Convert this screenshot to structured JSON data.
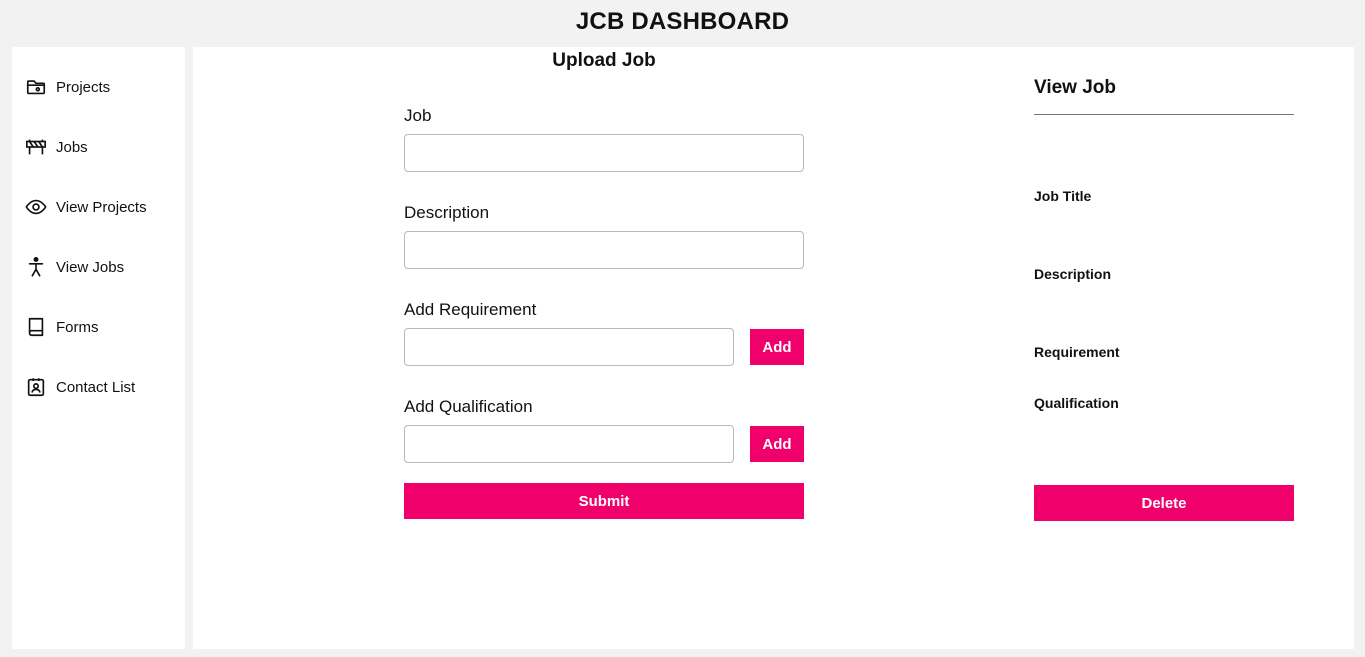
{
  "header": {
    "title": "JCB DASHBOARD"
  },
  "sidebar": {
    "items": [
      {
        "label": "Projects",
        "icon": "folder-icon"
      },
      {
        "label": "Jobs",
        "icon": "construction-barrier-icon"
      },
      {
        "label": "View Projects",
        "icon": "eye-icon"
      },
      {
        "label": "View Jobs",
        "icon": "person-icon"
      },
      {
        "label": "Forms",
        "icon": "book-icon"
      },
      {
        "label": "Contact List",
        "icon": "contact-card-icon"
      }
    ]
  },
  "upload": {
    "title": "Upload Job",
    "job_label": "Job",
    "job_value": "",
    "description_label": "Description",
    "description_value": "",
    "requirement_label": "Add Requirement",
    "requirement_value": "",
    "requirement_add": "Add",
    "qualification_label": "Add Qualification",
    "qualification_value": "",
    "qualification_add": "Add",
    "submit": "Submit"
  },
  "view": {
    "title": "View Job",
    "job_title_label": "Job Title",
    "description_label": "Description",
    "requirement_label": "Requirement",
    "qualification_label": "Qualification",
    "delete": "Delete"
  },
  "colors": {
    "accent": "#f0006a",
    "background": "#f2f2f2",
    "panel": "#ffffff"
  }
}
